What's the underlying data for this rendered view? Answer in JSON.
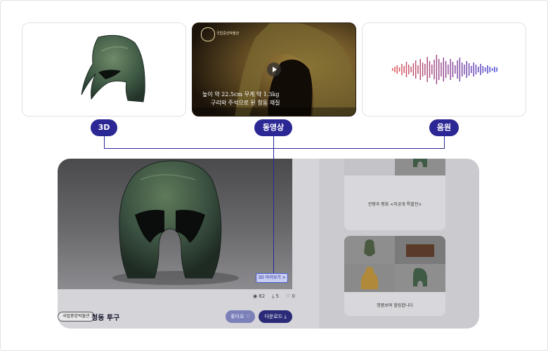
{
  "cards": {
    "video_caption_line1": "높이 약 22.5cm 무게 약 1.3kg",
    "video_caption_line2": "구리와 주석으로 된 청동 재질",
    "video_logo_text": "국립중앙박물관"
  },
  "labels": {
    "model3d": "3D",
    "video": "동영상",
    "audio": "음원"
  },
  "detail": {
    "view_3d_hint": "3D 미리보기 >",
    "stats": {
      "views": "82",
      "downloads": "5",
      "likes": "0"
    },
    "museum": "국립중앙박물관",
    "title": "청동 투구",
    "like_button": "좋아요 ♡",
    "download_button": "다운로드 ⤓"
  },
  "sidebar": {
    "item1_label": "전쟁과 평화 <미공개 특별전>",
    "item2_label": "명품보며 힐링합니다"
  },
  "colors": {
    "accent": "#2b2794",
    "waveform_from": "#e04a4a",
    "waveform_to": "#3a3ad0"
  }
}
